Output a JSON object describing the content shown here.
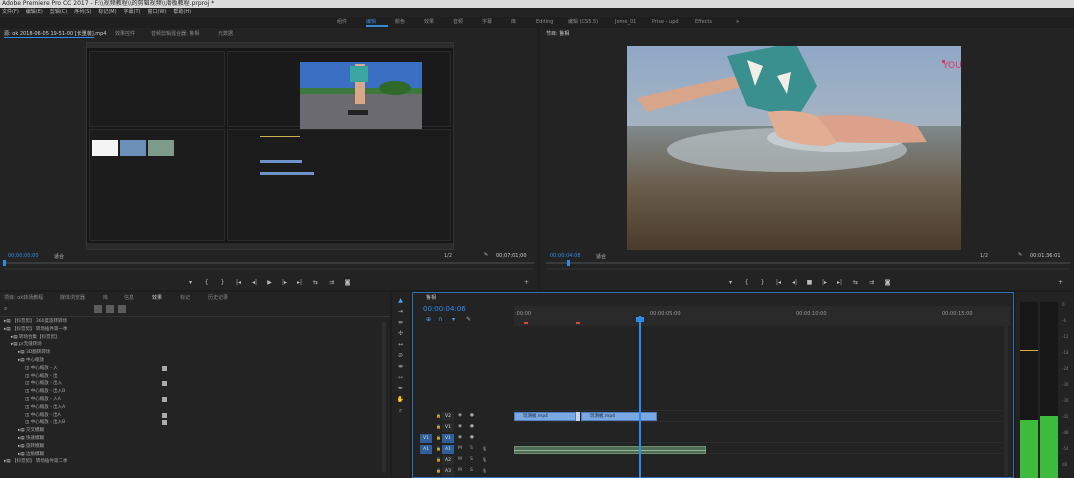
{
  "window": {
    "title": "Adobe Premiere Pro CC 2017 - F:\\\\视频教程\\\\的剪辑视频\\\\滑板教程.prproj *"
  },
  "menu": [
    "文件(F)",
    "编辑(E)",
    "剪辑(C)",
    "序列(S)",
    "标记(M)",
    "字幕(T)",
    "窗口(W)",
    "帮助(H)"
  ],
  "workspaces": [
    "组件",
    "编辑",
    "颜色",
    "效果",
    "音频",
    "字幕",
    "库",
    "Editing",
    "编辑 (CS5.5)",
    "Jome_01",
    "Prise - upd",
    "Effects"
  ],
  "workspace_more": "»",
  "source": {
    "tabs": [
      "源: ok 2018-06-05 19-51-00 [长重装].mp4",
      "效果控件",
      "音频剪辑混合器: 鲁相",
      "元数据"
    ],
    "timecode_left": "00;00;00;00",
    "fit": "适合",
    "fraction": "1/2",
    "timecode_right": "00;07;01;00"
  },
  "program": {
    "tabs": [
      "节目: 鲁相"
    ],
    "timecode_left": "00:00:04:08",
    "fit": "适合",
    "fraction": "1/2",
    "timecode_right": "00:01:36:01",
    "watermark": "YOUKU"
  },
  "transport": {
    "marker": "▾",
    "in": "{",
    "out": "}",
    "step_back": "|◂",
    "back": "◂|",
    "play": "▶",
    "fwd": "|▸",
    "step_fwd": "▸|",
    "insert": "⇆",
    "overwrite": "⇉",
    "export": "◙",
    "stop": "■",
    "add": "+"
  },
  "project": {
    "tabs": [
      "项目: ok转场教程",
      "媒体浏览器",
      "库",
      "信息",
      "效果",
      "标记",
      "历史记录"
    ],
    "tree": [
      "【抖音剪】 360度旋转转场",
      "【抖音剪】 转场插件第一季",
      "转场合集【抖音剪】",
      "pr无缝转场",
      "3D翻转转场",
      "中心缩放",
      "中心缩放 - 入",
      "中心缩放 - 出",
      "中心缩放 - 出入",
      "中心缩放 - 出入B",
      "中心缩放 - 入A",
      "中心缩放 - 出入A",
      "中心缩放 - 出A",
      "中心缩放 - 出入B",
      "交叉模糊",
      "快速模糊",
      "旋转模糊",
      "边角模糊",
      "【抖音剪】 转场插件第二季"
    ]
  },
  "timeline": {
    "tab": "鲁相",
    "timecode": "00:00:04:06",
    "ruler": [
      ":00:00",
      "00:00:05:00",
      "00:00:10:00",
      "00:00:15:00"
    ],
    "tracks": [
      {
        "target": "",
        "name": "V2"
      },
      {
        "target": "",
        "name": "V1"
      },
      {
        "target": "V1",
        "name": "V1"
      },
      {
        "target": "A1",
        "name": "A1"
      },
      {
        "target": "",
        "name": "A2"
      },
      {
        "target": "",
        "name": "A3"
      }
    ],
    "track_buttons": {
      "mute": "M",
      "solo": "S"
    },
    "clips": [
      "玩滑板.mp4",
      "玩滑板.mp4"
    ]
  },
  "meter": {
    "ticks": [
      "0",
      "-6",
      "-12",
      "-18",
      "-24",
      "-30",
      "-36",
      "-42",
      "-48",
      "-54",
      "dB"
    ],
    "left_level": 0.33,
    "right_level": 0.35
  },
  "colors": {
    "accent": "#2d8ceb",
    "clip": "#7aa8e0",
    "audio": "#4f6d54",
    "meter": "#3cbb3c"
  }
}
